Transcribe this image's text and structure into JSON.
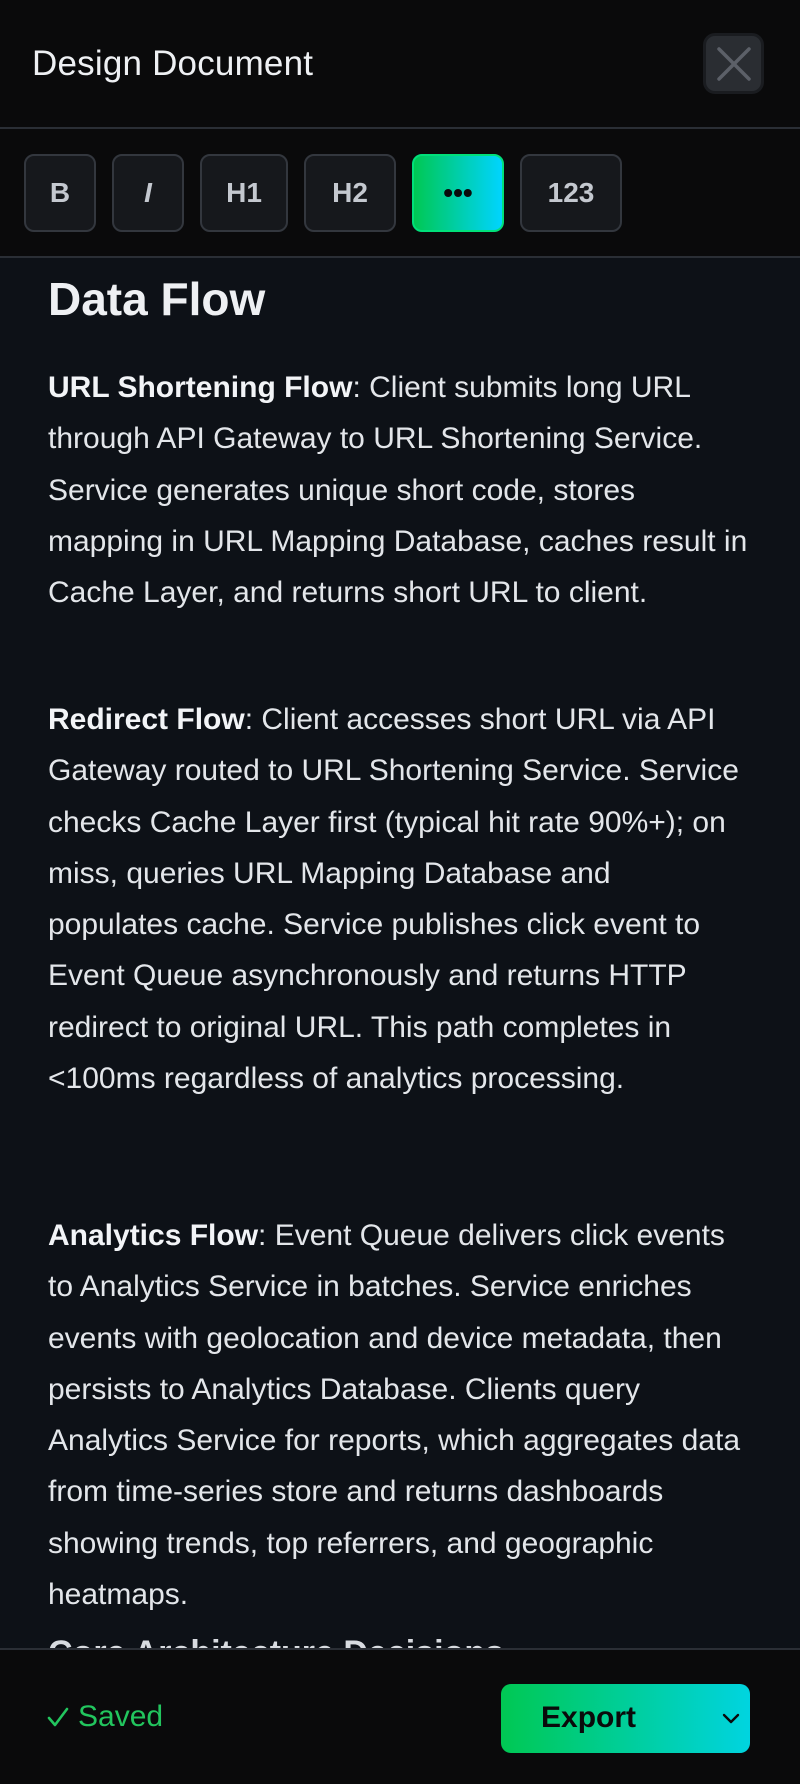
{
  "header": {
    "title": "Design Document",
    "close_icon": "close-icon"
  },
  "toolbar": {
    "buttons": [
      {
        "label": "B",
        "name": "bold"
      },
      {
        "label": "I",
        "name": "italic"
      },
      {
        "label": "H1",
        "name": "heading-1"
      },
      {
        "label": "H2",
        "name": "heading-2"
      },
      {
        "label": "•••",
        "name": "bullet-list",
        "active": true
      },
      {
        "label": "123",
        "name": "numbered-list"
      }
    ]
  },
  "content": {
    "heading": "Data Flow",
    "paragraphs": [
      {
        "bold": "URL Shortening Flow",
        "text": ": Client submits long URL through API Gateway to URL Shortening Service. Service generates unique short code, stores mapping in URL Mapping Database, caches result in Cache Layer, and returns short URL to client."
      },
      {
        "bold": "Redirect Flow",
        "text": ": Client accesses short URL via API Gateway routed to URL Shortening Service. Service checks Cache Layer first (typical hit rate 90%+); on miss, queries URL Mapping Database and populates cache. Service publishes click event to Event Queue asynchronously and returns HTTP redirect to original URL. This path completes in <100ms regardless of analytics processing."
      },
      {
        "bold": "Analytics Flow",
        "text": ": Event Queue delivers click events to Analytics Service in batches. Service enriches events with geolocation and device metadata, then persists to Analytics Database. Clients query Analytics Service for reports, which aggregates data from time-series store and returns dashboards showing trends, top referrers, and geographic heatmaps."
      }
    ],
    "cut_off_heading": "Core Architecture Decisions"
  },
  "footer": {
    "status": "Saved",
    "status_icon": "checkmark-icon",
    "export_label": "Export",
    "export_icon": "chevron-down-icon"
  },
  "colors": {
    "accent_start": "#00c853",
    "accent_end": "#00d4ff",
    "saved": "#22c55e",
    "background": "#0d1117"
  }
}
